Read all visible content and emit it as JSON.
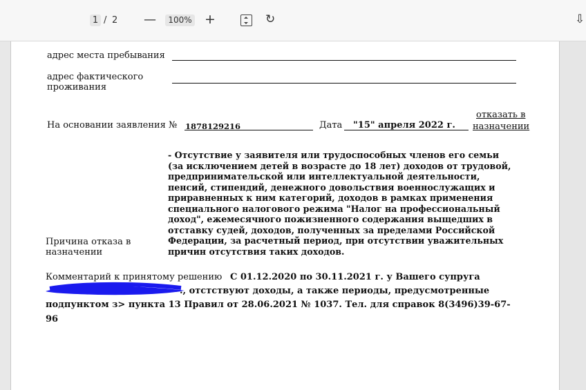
{
  "toolbar": {
    "current_page": "1",
    "separator": "/",
    "total_pages": "2",
    "zoom_out": "—",
    "zoom_level": "100%",
    "zoom_in": "+",
    "fit_icon": "fit-page-icon",
    "rotate_icon": "rotate-icon",
    "download_icon": "download-icon"
  },
  "document": {
    "stay_address_label": "адрес места пребывания",
    "actual_address_label_1": "адрес фактического",
    "actual_address_label_2": "проживания",
    "basis_label": "На основании заявления №",
    "application_number": "1878129216",
    "date_label": "Дата",
    "date_value": "\"15\" апреля 2022 г.",
    "decision_line_1": "отказать в",
    "decision_line_2": "назначении",
    "refusal_label_1": "Причина отказа в",
    "refusal_label_2": "назначении",
    "refusal_text": "- Отсутствие у заявителя или трудоспособных членов его семьи\n(за исключением детей в возрасте до 18 лет) доходов от трудовой,\nпредпринимательской или интеллектуальной деятельности,\nпенсий, стипендий, денежного довольствия военнослужащих и\nприравненных к ним категорий, доходов в рамках применения\nспециального налогового режима \"Налог на профессиональный\nдоход\", ежемесячного пожизненного содержания выщедших в\nотставку судей, доходов, полученных за пределами Российской\nФедерации, за расчетный период, при отсутствии уважительных\nпричин отсутствия таких доходов.",
    "comment_label": "Комментарий к принятому решению",
    "comment_line_1": "С 01.12.2020 по 30.11.2021 г. у Вашего супруга",
    "comment_line_2": "., отстствуют доходы, а также периоды, предусмотренные",
    "comment_line_3": "подпунктом з> пункта 13 Правил от 28.06.2021 № 1037. Тел. для справок 8(3496)39-67-",
    "comment_line_4": "96"
  },
  "colors": {
    "redaction": "#1a1aee"
  }
}
